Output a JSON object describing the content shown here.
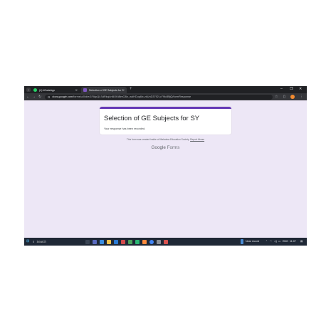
{
  "browser": {
    "tabs": [
      {
        "label": "(4) WhatsApp",
        "icon": "whatsapp-icon",
        "color": "#25d366",
        "active": false
      },
      {
        "label": "Selection of GE Subjects for SY",
        "icon": "google-forms-icon",
        "color": "#7e57c2",
        "active": true
      }
    ],
    "url_host": "docs.google.com",
    "url_path": "/forms/u/0/d/e/1FAIpQLSdRkcj4nBOKi8lmC8lz_wdHDuq6ix-zkUnD3792Lv79k4BfjQ/formResponse"
  },
  "form": {
    "title": "Selection of GE Subjects for SY",
    "confirmation": "Your response has been recorded.",
    "footnote_text": "This form was created inside of Mahatma Education Society.",
    "report_link": "Report Abuse",
    "brand_google": "Google",
    "brand_forms": "Forms"
  },
  "taskbar": {
    "search_label": "Search",
    "weather_text": "Near record",
    "language": "ENG",
    "time": "11:07"
  },
  "colors": {
    "accent": "#673ab7",
    "page_background": "#ede7f6",
    "taskbar": "#1f2836"
  }
}
